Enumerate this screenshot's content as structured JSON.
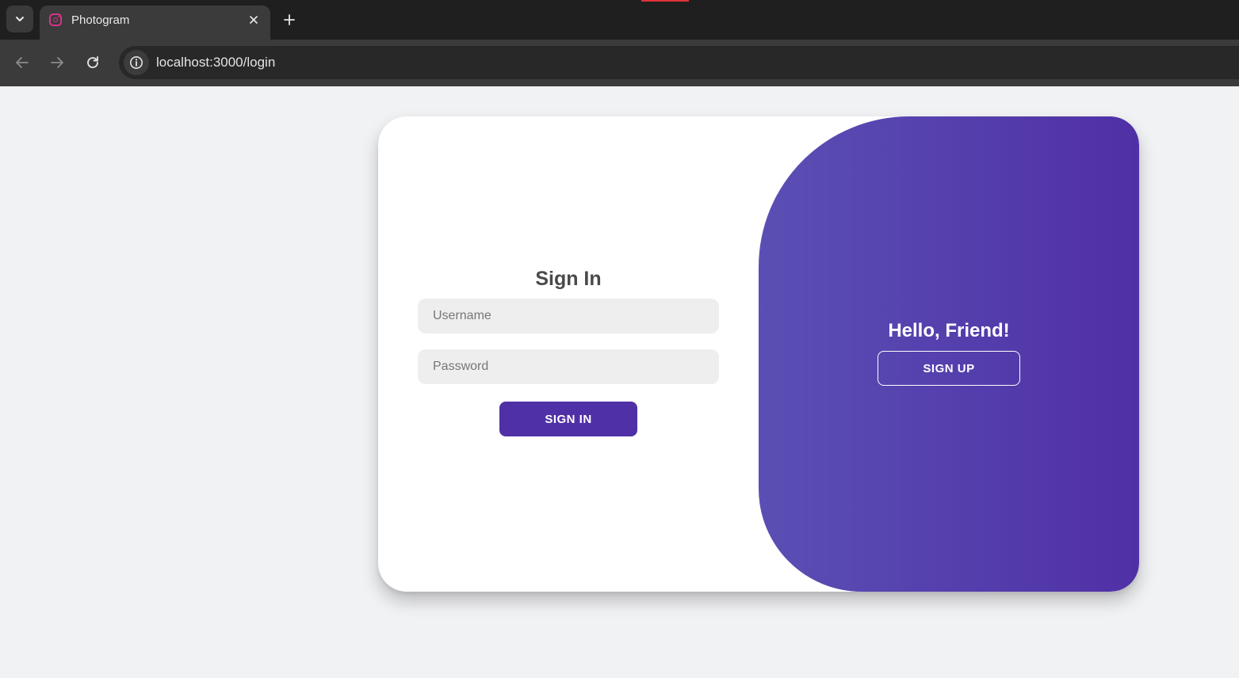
{
  "browser": {
    "tab": {
      "title": "Photogram",
      "favicon": "instagram-icon"
    },
    "address_bar": {
      "url": "localhost:3000/login"
    },
    "icons": {
      "tab_dropdown": "chevron-down-icon",
      "tab_close": "close-icon",
      "new_tab": "plus-icon",
      "back": "arrow-left-icon",
      "forward": "arrow-right-icon",
      "reload": "reload-icon",
      "site_info": "info-icon"
    }
  },
  "signin": {
    "title": "Sign In",
    "username_placeholder": "Username",
    "password_placeholder": "Password",
    "button_label": "SIGN IN"
  },
  "overlay": {
    "heading": "Hello, Friend!",
    "button_label": "SIGN UP"
  },
  "colors": {
    "accent": "#5030a6",
    "overlay_gradient_start": "#5a4fb4",
    "overlay_gradient_end": "#5030a6",
    "page_background": "#f1f2f4"
  }
}
